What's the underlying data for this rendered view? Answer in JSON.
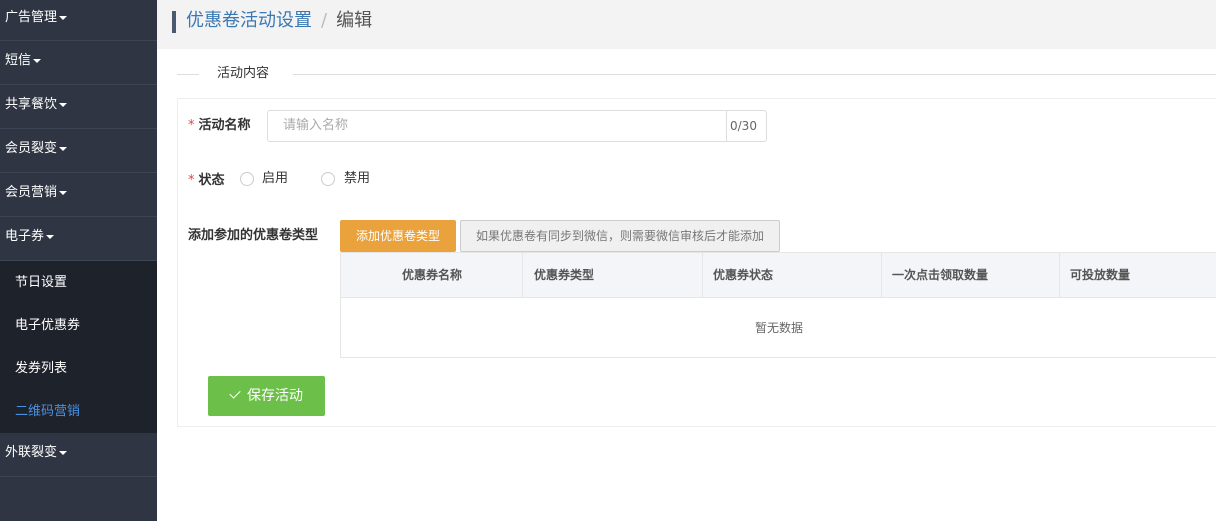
{
  "sidebar": {
    "items": [
      {
        "label": "广告管理"
      },
      {
        "label": "短信"
      },
      {
        "label": "共享餐饮"
      },
      {
        "label": "会员裂变"
      },
      {
        "label": "会员营销"
      },
      {
        "label": "电子券"
      }
    ],
    "submenu": [
      {
        "label": "节日设置"
      },
      {
        "label": "电子优惠券"
      },
      {
        "label": "发券列表"
      },
      {
        "label": "二维码营销",
        "active": true
      }
    ],
    "after": [
      {
        "label": "外联裂变"
      }
    ]
  },
  "breadcrumb": {
    "parent": "优惠卷活动设置",
    "separator": "/",
    "current": "编辑"
  },
  "section": {
    "title": "活动内容"
  },
  "form": {
    "name_label": "活动名称",
    "name_placeholder": "请输入名称",
    "name_count": "0/30",
    "status_label": "状态",
    "status_options": [
      "启用",
      "禁用"
    ],
    "coupon_type_label": "添加参加的优惠卷类型",
    "add_button": "添加优惠卷类型",
    "hint_button": "如果优惠卷有同步到微信，则需要微信审核后才能添加",
    "required_mark": "*"
  },
  "table": {
    "columns": [
      "优惠券名称",
      "优惠券类型",
      "优惠券状态",
      "一次点击领取数量",
      "可投放数量"
    ],
    "empty_text": "暂无数据"
  },
  "save_button": "保存活动",
  "colors": {
    "sidebar_bg": "#2f3542",
    "active_link": "#4a90e2",
    "orange": "#eaa23c",
    "green": "#6cc04a",
    "required": "#e64242"
  }
}
